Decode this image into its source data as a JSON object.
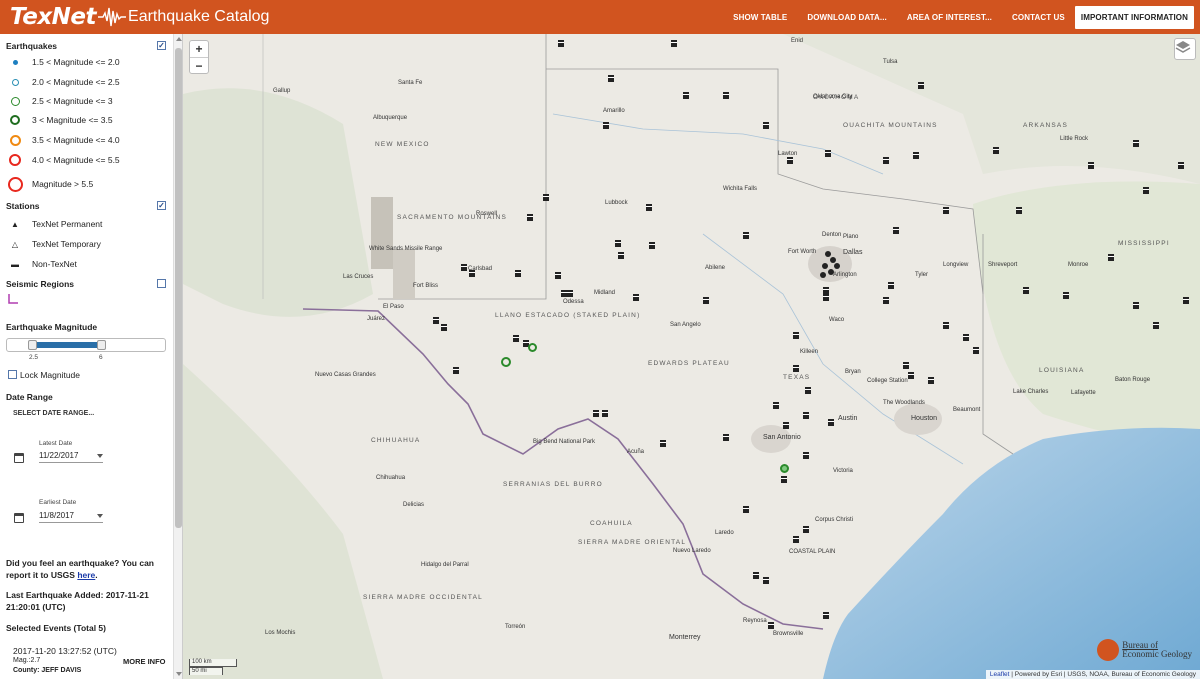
{
  "header": {
    "logo": "TexNet",
    "title": "Earthquake Catalog",
    "nav": [
      "SHOW TABLE",
      "DOWNLOAD DATA...",
      "AREA OF INTEREST...",
      "CONTACT US",
      "IMPORTANT INFORMATION"
    ]
  },
  "sidebar": {
    "earthquakes_heading": "Earthquakes",
    "legend": [
      {
        "label": "1.5 < Magnitude <= 2.0",
        "color": "#1d7fc0"
      },
      {
        "label": "2.0 < Magnitude <= 2.5",
        "color": "#2a8fb4"
      },
      {
        "label": "2.5 < Magnitude <= 3",
        "color": "#2b8a2b"
      },
      {
        "label": "3 < Magnitude <= 3.5",
        "color": "#1f6d1f"
      },
      {
        "label": "3.5 < Magnitude <= 4.0",
        "color": "#f08a12"
      },
      {
        "label": "4.0 < Magnitude <= 5.5",
        "color": "#e8281e"
      },
      {
        "label": "Magnitude > 5.5",
        "color": "#e8281e"
      }
    ],
    "stations_heading": "Stations",
    "stations": [
      "TexNet Permanent",
      "TexNet Temporary",
      "Non-TexNet"
    ],
    "seismic_regions": "Seismic Regions",
    "magnitude_heading": "Earthquake Magnitude",
    "magnitude_min": "2.5",
    "magnitude_max": "6",
    "magnitude_range": [
      2.5,
      6
    ],
    "lock_magnitude": "Lock Magnitude",
    "date_range_heading": "Date Range",
    "select_date_range": "SELECT DATE RANGE...",
    "latest_date_label": "Latest Date",
    "latest_date": "11/22/2017",
    "earliest_date_label": "Earliest Date",
    "earliest_date": "11/8/2017",
    "felt_text": "Did you feel an earthquake? You can report it to USGS",
    "felt_link": "here",
    "last_added": "Last Earthquake Added: 2017-11-21 21:20:01 (UTC)",
    "selected_events": "Selected Events (Total 5)",
    "event": {
      "time": "2017-11-20 13:27:52 (UTC)",
      "mag": "Mag.:2.7",
      "more": "MORE INFO",
      "county": "County: JEFF DAVIS"
    }
  },
  "map": {
    "zoom_in": "+",
    "zoom_out": "−",
    "scale_km": "100 km",
    "scale_mi": "50 mi",
    "attribution_link": "Leaflet",
    "attribution": "| Powered by Esri | USGS, NOAA, Bureau of Economic Geology",
    "beg_line1": "Bureau of",
    "beg_line2": "Economic Geology",
    "labels": {
      "dallas": "Dallas",
      "fortworth": "Fort Worth",
      "austin": "Austin",
      "sanantonio": "San Antonio",
      "houston": "Houston",
      "elpaso": "El Paso",
      "juarez": "Juárez",
      "lubbock": "Lubbock",
      "amarillo": "Amarillo",
      "midland": "Midland",
      "odessa": "Odessa",
      "sanangelo": "San Angelo",
      "abilene": "Abilene",
      "wichitafalls": "Wichita Falls",
      "waco": "Waco",
      "killeen": "Killeen",
      "bryan": "Bryan",
      "collegestation": "College Station",
      "beaumont": "Beaumont",
      "lakecharles": "Lake Charles",
      "lafayette": "Lafayette",
      "batonrouge": "Baton Rouge",
      "shreveport": "Shreveport",
      "tyler": "Tyler",
      "longview": "Longview",
      "monroe": "Monroe",
      "oklahomacity": "Oklahoma City",
      "tulsa": "Tulsa",
      "littlerock": "Little Rock",
      "lawton": "Lawton",
      "corpus": "Corpus Christi",
      "victoria": "Victoria",
      "laredo": "Laredo",
      "nuevolaredo": "Nuevo Laredo",
      "brownsville": "Brownsville",
      "reynosa": "Reynosa",
      "monterrey": "Monterrey",
      "chihuahua": "Chihuahua",
      "delicias": "Delicias",
      "acuna": "Acuña",
      "roswell": "Roswell",
      "lascruces": "Las Cruces",
      "albuquerque": "Albuquerque",
      "santafe": "Santa Fe",
      "carlsbad": "Carlsbad",
      "denton": "Denton",
      "arlington": "Arlington",
      "plano": "Plano",
      "thewoodlands": "The Woodlands",
      "llano": "LLANO ESTACADO (STAKED PLAIN)",
      "edwards": "EDWARDS PLATEAU",
      "ouachita": "OUACHITA MOUNTAINS",
      "coastal": "COASTAL PLAIN",
      "sierramadre": "SIERRA MADRE ORIENTAL",
      "texas": "TEXAS",
      "newmexico": "NEW MEXICO",
      "oklahoma": "OKLAHOMA",
      "arkansas": "ARKANSAS",
      "louisiana": "LOUISIANA",
      "coahuila": "COAHUILA",
      "chihuahuastate": "CHIHUAHUA",
      "mississippi": "MISSISSIPPI",
      "sacramento": "SACRAMENTO MOUNTAINS",
      "serranias": "SERRANIAS DEL BURRO",
      "bigbend": "Big Bend National Park",
      "fortbliss": "Fort Bliss",
      "whitesands": "White Sands Missile Range",
      "nuevocasas": "Nuevo Casas Grandes",
      "hidalgo": "Hidalgo del Parral",
      "losmochis": "Los Mochis",
      "torreon": "Torreón",
      "gallup": "Gallup",
      "enid": "Enid",
      "sierramadreocc": "SIERRA MADRE OCCIDENTAL"
    }
  },
  "colors": {
    "header": "#d1541f",
    "quake_green": "#2b8a2b",
    "highlight": "#1a3aa8"
  }
}
